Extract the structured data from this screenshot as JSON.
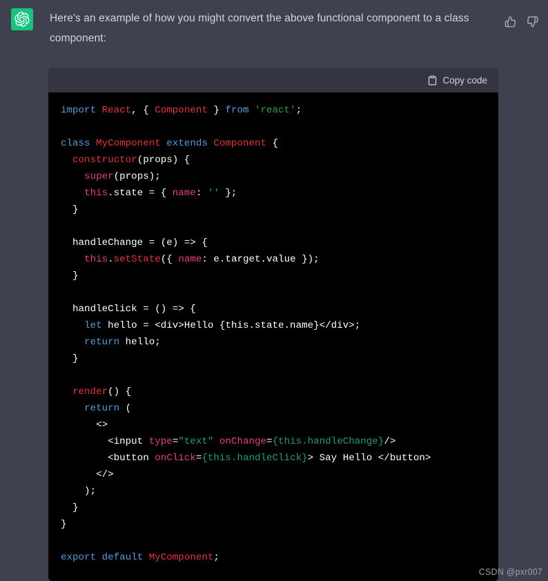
{
  "message": {
    "avatar_icon": "chatgpt-logo-icon",
    "text": "Here's an example of how you might convert the above functional component to a class component:",
    "actions": [
      {
        "name": "thumbs-up",
        "icon": "thumbs-up-icon",
        "label": "Good response"
      },
      {
        "name": "thumbs-down",
        "icon": "thumbs-down-icon",
        "label": "Bad response"
      }
    ]
  },
  "code_block": {
    "copy_label": "Copy code",
    "copy_icon": "clipboard-icon",
    "language": "jsx",
    "lines": [
      {
        "tokens": [
          {
            "t": "import ",
            "c": "kw"
          },
          {
            "t": "React",
            "c": "cls"
          },
          {
            "t": ", { ",
            "c": "pun"
          },
          {
            "t": "Component",
            "c": "cls"
          },
          {
            "t": " } ",
            "c": "pun"
          },
          {
            "t": "from ",
            "c": "kw"
          },
          {
            "t": "'react'",
            "c": "str"
          },
          {
            "t": ";",
            "c": "pun"
          }
        ]
      },
      {
        "tokens": []
      },
      {
        "tokens": [
          {
            "t": "class ",
            "c": "kw"
          },
          {
            "t": "MyComponent ",
            "c": "cls"
          },
          {
            "t": "extends ",
            "c": "kw"
          },
          {
            "t": "Component",
            "c": "cls"
          },
          {
            "t": " {",
            "c": "pun"
          }
        ]
      },
      {
        "tokens": [
          {
            "t": "  ",
            "c": "pun"
          },
          {
            "t": "constructor",
            "c": "cls"
          },
          {
            "t": "(props) {",
            "c": "pun"
          }
        ]
      },
      {
        "tokens": [
          {
            "t": "    ",
            "c": "pun"
          },
          {
            "t": "super",
            "c": "this"
          },
          {
            "t": "(props);",
            "c": "pun"
          }
        ]
      },
      {
        "tokens": [
          {
            "t": "    ",
            "c": "pun"
          },
          {
            "t": "this",
            "c": "this"
          },
          {
            "t": ".state = { ",
            "c": "pun"
          },
          {
            "t": "name",
            "c": "this"
          },
          {
            "t": ": ",
            "c": "pun"
          },
          {
            "t": "''",
            "c": "teal"
          },
          {
            "t": " };",
            "c": "pun"
          }
        ]
      },
      {
        "tokens": [
          {
            "t": "  }",
            "c": "pun"
          }
        ]
      },
      {
        "tokens": []
      },
      {
        "tokens": [
          {
            "t": "  handleChange = (e) => {",
            "c": "pun"
          }
        ]
      },
      {
        "tokens": [
          {
            "t": "    ",
            "c": "pun"
          },
          {
            "t": "this",
            "c": "this"
          },
          {
            "t": ".",
            "c": "pun"
          },
          {
            "t": "setState",
            "c": "cls"
          },
          {
            "t": "({ ",
            "c": "pun"
          },
          {
            "t": "name",
            "c": "this"
          },
          {
            "t": ": e.target.value });",
            "c": "pun"
          }
        ]
      },
      {
        "tokens": [
          {
            "t": "  }",
            "c": "pun"
          }
        ]
      },
      {
        "tokens": []
      },
      {
        "tokens": [
          {
            "t": "  handleClick = () => {",
            "c": "pun"
          }
        ]
      },
      {
        "tokens": [
          {
            "t": "    ",
            "c": "pun"
          },
          {
            "t": "let",
            "c": "kw"
          },
          {
            "t": " hello = <div>Hello {this.state.name}</div>;",
            "c": "pun"
          }
        ]
      },
      {
        "tokens": [
          {
            "t": "    ",
            "c": "pun"
          },
          {
            "t": "return",
            "c": "kw"
          },
          {
            "t": " hello;",
            "c": "pun"
          }
        ]
      },
      {
        "tokens": [
          {
            "t": "  }",
            "c": "pun"
          }
        ]
      },
      {
        "tokens": []
      },
      {
        "tokens": [
          {
            "t": "  ",
            "c": "pun"
          },
          {
            "t": "render",
            "c": "cls"
          },
          {
            "t": "() {",
            "c": "pun"
          }
        ]
      },
      {
        "tokens": [
          {
            "t": "    ",
            "c": "pun"
          },
          {
            "t": "return",
            "c": "kw"
          },
          {
            "t": " (",
            "c": "pun"
          }
        ]
      },
      {
        "tokens": [
          {
            "t": "      <>",
            "c": "pun"
          }
        ]
      },
      {
        "tokens": [
          {
            "t": "        <input ",
            "c": "pun"
          },
          {
            "t": "type",
            "c": "this"
          },
          {
            "t": "=",
            "c": "pun"
          },
          {
            "t": "\"text\"",
            "c": "jsx"
          },
          {
            "t": " ",
            "c": "pun"
          },
          {
            "t": "onChange",
            "c": "this"
          },
          {
            "t": "=",
            "c": "pun"
          },
          {
            "t": "{this.handleChange}",
            "c": "jsx"
          },
          {
            "t": "/>",
            "c": "pun"
          }
        ]
      },
      {
        "tokens": [
          {
            "t": "        <button ",
            "c": "pun"
          },
          {
            "t": "onClick",
            "c": "this"
          },
          {
            "t": "=",
            "c": "pun"
          },
          {
            "t": "{this.handleClick}",
            "c": "jsx"
          },
          {
            "t": "> Say Hello </button>",
            "c": "pun"
          }
        ]
      },
      {
        "tokens": [
          {
            "t": "      </>",
            "c": "pun"
          }
        ]
      },
      {
        "tokens": [
          {
            "t": "    );",
            "c": "pun"
          }
        ]
      },
      {
        "tokens": [
          {
            "t": "  }",
            "c": "pun"
          }
        ]
      },
      {
        "tokens": [
          {
            "t": "}",
            "c": "pun"
          }
        ]
      },
      {
        "tokens": []
      },
      {
        "tokens": [
          {
            "t": "export ",
            "c": "kw"
          },
          {
            "t": "default ",
            "c": "kw"
          },
          {
            "t": "MyComponent",
            "c": "cls"
          },
          {
            "t": ";",
            "c": "pun"
          }
        ]
      }
    ]
  },
  "watermark": "CSDN @pxr007",
  "colors": {
    "page_background": "#40414f",
    "code_header": "#343541",
    "code_background": "#000000",
    "avatar_green": "#19c37d",
    "text": "#d1d5db",
    "keyword": "#569cd6",
    "class_name": "#e0393b",
    "string": "#2ea043",
    "this_keyword": "#e0457b",
    "jsx_value": "#2a9d6f"
  }
}
